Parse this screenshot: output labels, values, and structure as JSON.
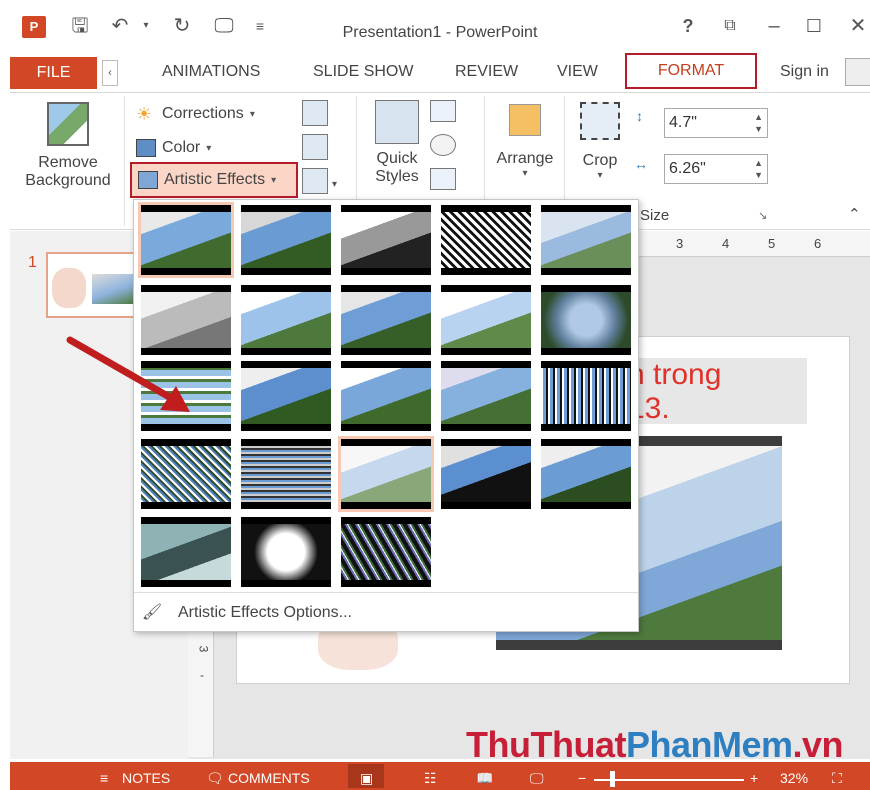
{
  "window": {
    "title": "Presentation1 - PowerPoint",
    "app_icon": "Pə",
    "help": "?",
    "controls": [
      "–",
      "☐",
      "✕"
    ]
  },
  "tabs": {
    "file": "FILE",
    "items": [
      "ANIMATIONS",
      "SLIDE SHOW",
      "REVIEW",
      "VIEW"
    ],
    "active": "FORMAT",
    "signin": "Sign in"
  },
  "ribbon": {
    "remove_background": "Remove Background",
    "remove_line1": "Remove",
    "remove_line2": "Background",
    "corrections": "Corrections",
    "color": "Color",
    "artistic_effects": "Artistic Effects",
    "quick_styles_line1": "Quick",
    "quick_styles_line2": "Styles",
    "arrange": "Arrange",
    "crop": "Crop",
    "height_value": "4.7\"",
    "width_value": "6.26\"",
    "size_label": "Size"
  },
  "thumbnail": {
    "number": "1"
  },
  "ruler": {
    "marks": [
      "3",
      "4",
      "5",
      "6"
    ],
    "left_marks": [
      "3",
      "-"
    ]
  },
  "slide": {
    "title_line1": "n trong",
    "title_line2": "13."
  },
  "gallery": {
    "options_label": "Artistic Effects Options...",
    "rows": 5,
    "selected_first": true
  },
  "statusbar": {
    "notes": "NOTES",
    "comments": "COMMENTS",
    "zoom": "32%"
  },
  "watermark": {
    "part1": "ThuThuat",
    "part2": "PhanMem",
    "part3": ".vn"
  },
  "colors": {
    "accent": "#d24726",
    "highlight_border": "#b51c2a",
    "format_tab": "#c43e1c"
  }
}
